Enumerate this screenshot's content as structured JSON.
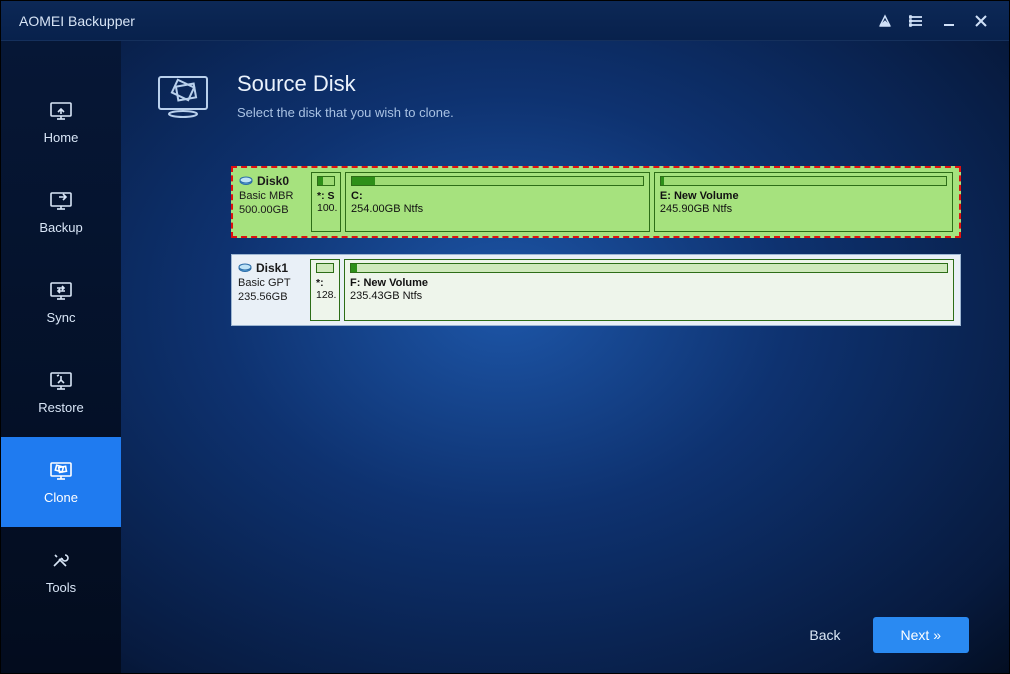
{
  "app": {
    "title": "AOMEI Backupper"
  },
  "sidebar": {
    "items": [
      {
        "label": "Home"
      },
      {
        "label": "Backup"
      },
      {
        "label": "Sync"
      },
      {
        "label": "Restore"
      },
      {
        "label": "Clone"
      },
      {
        "label": "Tools"
      }
    ],
    "active_index": 4
  },
  "header": {
    "title": "Source Disk",
    "subtitle": "Select the disk that you wish to clone."
  },
  "disks": [
    {
      "name": "Disk0",
      "type": "Basic MBR",
      "size": "500.00GB",
      "selected": true,
      "partitions": [
        {
          "label1": "*: S",
          "label2": "100.",
          "fill_pct": 30,
          "flex": 0.05,
          "tiny": true
        },
        {
          "label1": "C:",
          "label2": "254.00GB Ntfs",
          "fill_pct": 8,
          "flex": 1
        },
        {
          "label1": "E: New Volume",
          "label2": "245.90GB Ntfs",
          "fill_pct": 1,
          "flex": 0.98
        }
      ]
    },
    {
      "name": "Disk1",
      "type": "Basic GPT",
      "size": "235.56GB",
      "selected": false,
      "partitions": [
        {
          "label1": "*:",
          "label2": "128.",
          "fill_pct": 0,
          "flex": 0.05,
          "tiny": true
        },
        {
          "label1": "F: New Volume",
          "label2": "235.43GB Ntfs",
          "fill_pct": 1,
          "flex": 1
        }
      ]
    }
  ],
  "footer": {
    "back": "Back",
    "next": "Next »"
  }
}
